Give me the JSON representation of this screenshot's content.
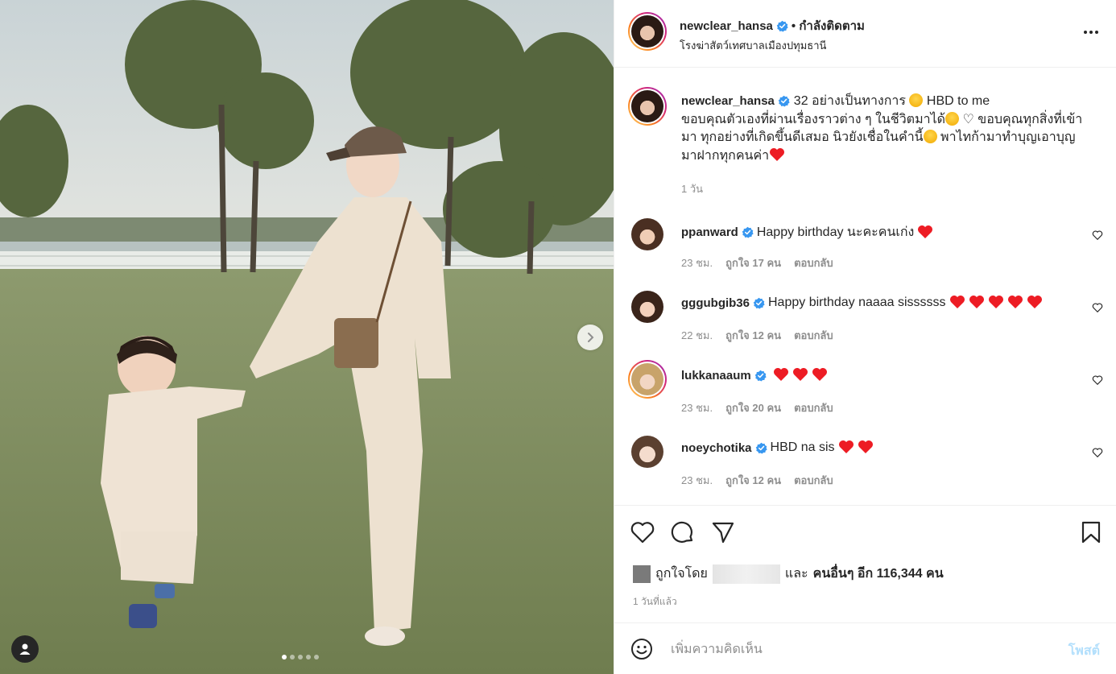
{
  "post": {
    "owner": {
      "username": "newclear_hansa",
      "follow_status": "• กำลังติดตาม",
      "location": "โรงฆ่าสัตว์เทศบาลเมืองปทุมธานี"
    },
    "caption": {
      "username": "newclear_hansa",
      "line1_a": " 32 อย่างเป็นทางการ ",
      "line1_b": " HBD to me",
      "line2_a": "ขอบคุณตัวเองที่ผ่านเรื่องราวต่าง ๆ ในชีวิตมาได้",
      "line2_b": " ♡ ขอบคุณทุกสิ่งที่เข้า",
      "line3_a": "มา ทุกอย่างที่เกิดขึ้นดีเสมอ นิวยังเชื่อในคำนี้",
      "line3_b": " พาไทก้ามาทำบุญเอาบุญ",
      "line4": "มาฝากทุกคนค่า",
      "time": "1 วัน"
    },
    "comments": [
      {
        "username": "ppanward",
        "text": "Happy birthday นะคะคนเก่ง",
        "hearts": 1,
        "time": "23 ชม.",
        "likes": "ถูกใจ 17 คน",
        "reply": "ตอบกลับ"
      },
      {
        "username": "gggubgib36",
        "text": "Happy birthday naaaa sissssss",
        "hearts": 5,
        "time": "22 ชม.",
        "likes": "ถูกใจ 12 คน",
        "reply": "ตอบกลับ"
      },
      {
        "username": "lukkanaaum",
        "text": "",
        "hearts": 3,
        "time": "23 ชม.",
        "likes": "ถูกใจ 20 คน",
        "reply": "ตอบกลับ"
      },
      {
        "username": "noeychotika",
        "text": "HBD na sis",
        "hearts": 2,
        "time": "23 ชม.",
        "likes": "ถูกใจ 12 คน",
        "reply": "ตอบกลับ"
      }
    ],
    "likes": {
      "liked_by": "ถูกใจโดย",
      "and": "และ",
      "others": "คนอื่นๆ อีก 116,344 คน"
    },
    "posted_ago": "1 วันที่แล้ว",
    "add_comment": {
      "placeholder": "เพิ่มความคิดเห็น",
      "post_label": "โพสต์"
    },
    "carousel": {
      "slides": 5,
      "active_index": 0
    }
  },
  "colors": {
    "verified": "#3897f0",
    "heart": "#ed1c24",
    "muted_text": "#8e8e8e",
    "post_button_disabled": "#b2dffc"
  },
  "icons": {
    "next": "chevron-right-icon",
    "user_tag": "user-icon",
    "more": "more-horizontal-icon",
    "like": "heart-outline-icon",
    "comment": "comment-icon",
    "share": "paper-plane-icon",
    "save": "bookmark-icon",
    "emoji": "emoji-icon",
    "verified": "verified-badge-icon"
  }
}
